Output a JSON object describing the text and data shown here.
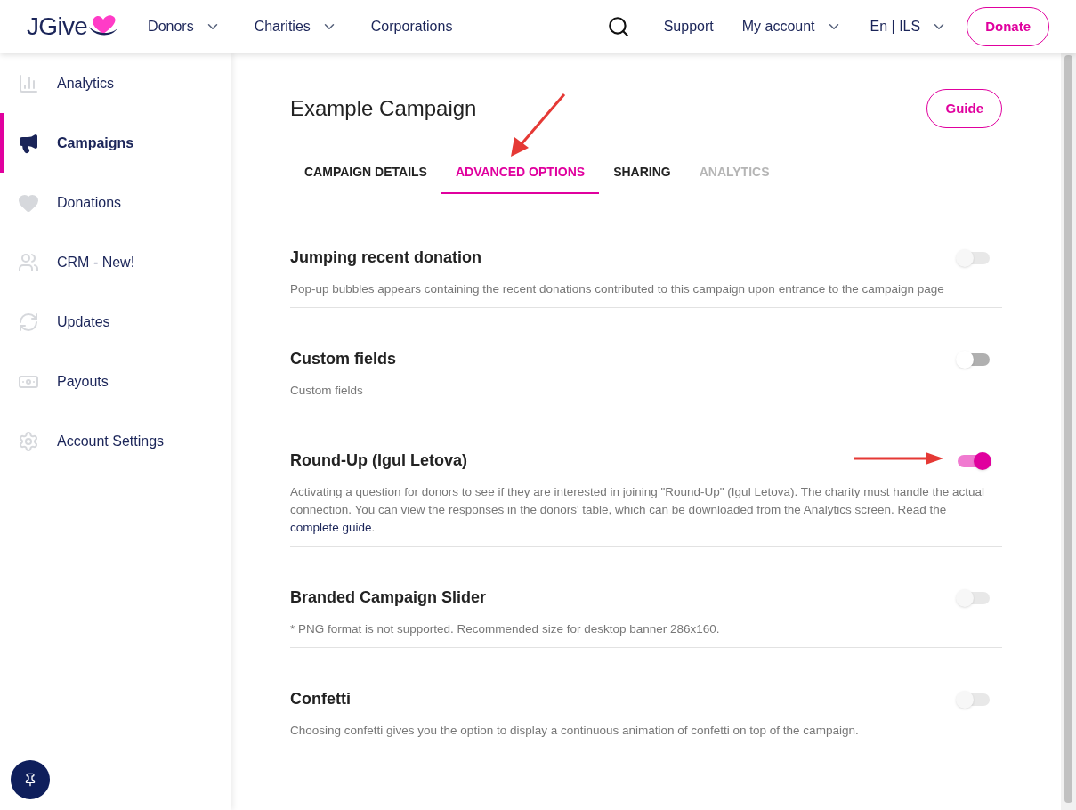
{
  "header": {
    "logo": "JGive",
    "nav": [
      {
        "label": "Donors",
        "dropdown": true
      },
      {
        "label": "Charities",
        "dropdown": true
      },
      {
        "label": "Corporations",
        "dropdown": false
      }
    ],
    "right_nav": [
      {
        "label": "Support",
        "dropdown": false
      },
      {
        "label": "My account",
        "dropdown": true
      },
      {
        "label": "En | ILS",
        "dropdown": true
      }
    ],
    "donate_button": "Donate"
  },
  "sidebar": {
    "items": [
      {
        "label": "Analytics",
        "selected": false
      },
      {
        "label": "Campaigns",
        "selected": true
      },
      {
        "label": "Donations",
        "selected": false
      },
      {
        "label": "CRM - New!",
        "selected": false
      },
      {
        "label": "Updates",
        "selected": false
      },
      {
        "label": "Payouts",
        "selected": false
      },
      {
        "label": "Account Settings",
        "selected": false
      }
    ]
  },
  "page": {
    "title": "Example Campaign",
    "guide_button": "Guide",
    "tabs": [
      {
        "label": "CAMPAIGN DETAILS",
        "selected": false,
        "disabled": false
      },
      {
        "label": "ADVANCED OPTIONS",
        "selected": true,
        "disabled": false
      },
      {
        "label": "SHARING",
        "selected": false,
        "disabled": false
      },
      {
        "label": "ANALYTICS",
        "selected": false,
        "disabled": true
      }
    ],
    "options": [
      {
        "title": "Jumping recent donation",
        "description": "Pop-up bubbles appears containing the recent donations contributed to this campaign upon entrance to the campaign page",
        "on": false,
        "disabled": true,
        "annotated": false
      },
      {
        "title": "Custom fields",
        "description": "Custom fields",
        "on": false,
        "disabled": false,
        "annotated": false
      },
      {
        "title": "Round-Up (Igul Letova)",
        "description": "Activating a question for donors to see if they are interested in joining \"Round-Up\" (Igul Letova). The charity must handle the actual connection. You can view the responses in the donors' table, which can be downloaded from the Analytics screen. Read the",
        "link": "complete guide",
        "after_link": ".",
        "on": true,
        "disabled": false,
        "annotated": true
      },
      {
        "title": "Branded Campaign Slider",
        "description": "* PNG format is not supported. Recommended size for desktop banner 286x160.",
        "on": false,
        "disabled": true,
        "annotated": false
      },
      {
        "title": "Confetti",
        "description": "Choosing confetti gives you the option to display a continuous animation of confetti on top of the campaign.",
        "on": false,
        "disabled": true,
        "annotated": false
      }
    ]
  }
}
